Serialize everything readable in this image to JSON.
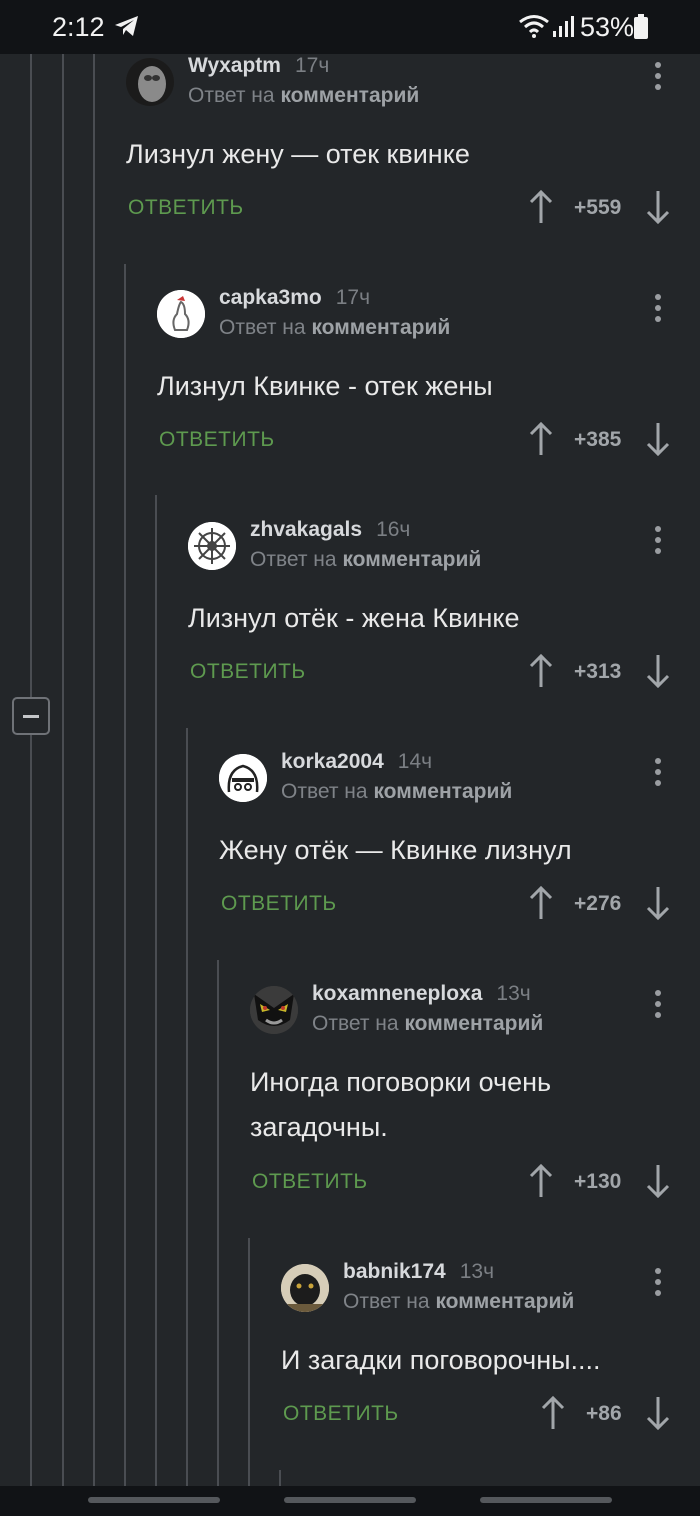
{
  "status": {
    "time": "2:12",
    "battery": "53%"
  },
  "comments": [
    {
      "user": "Wyxaptm",
      "time": "17ч",
      "reply_prefix": "Ответ на",
      "reply_target": "комментарий",
      "text": [
        "Лизнул жену — отек квинке"
      ],
      "reply_label": "ОТВЕТИТЬ",
      "score": "+559"
    },
    {
      "user": "capka3mo",
      "time": "17ч",
      "reply_prefix": "Ответ на",
      "reply_target": "комментарий",
      "text": [
        "Лизнул Квинке - отек жены"
      ],
      "reply_label": "ОТВЕТИТЬ",
      "score": "+385"
    },
    {
      "user": "zhvakagals",
      "time": "16ч",
      "reply_prefix": "Ответ на",
      "reply_target": "комментарий",
      "text": [
        "Лизнул отёк - жена Квинке"
      ],
      "reply_label": "ОТВЕТИТЬ",
      "score": "+313"
    },
    {
      "user": "korka2004",
      "time": "14ч",
      "reply_prefix": "Ответ на",
      "reply_target": "комментарий",
      "text": [
        "Жену отёк — Квинке лизнул"
      ],
      "reply_label": "ОТВЕТИТЬ",
      "score": "+276"
    },
    {
      "user": "koxamneneploxa",
      "time": "13ч",
      "reply_prefix": "Ответ на",
      "reply_target": "комментарий",
      "text": [
        "Иногда поговорки очень",
        "загадочны."
      ],
      "reply_label": "ОТВЕТИТЬ",
      "score": "+130"
    },
    {
      "user": "babnik174",
      "time": "13ч",
      "reply_prefix": "Ответ на",
      "reply_target": "комментарий",
      "text": [
        "И загадки поговорочны...."
      ],
      "reply_label": "ОТВЕТИТЬ",
      "score": "+86"
    }
  ],
  "colors": {
    "background": "#232629",
    "reply_accent": "#5e9a4f",
    "thread_line": "#4a4d52"
  }
}
